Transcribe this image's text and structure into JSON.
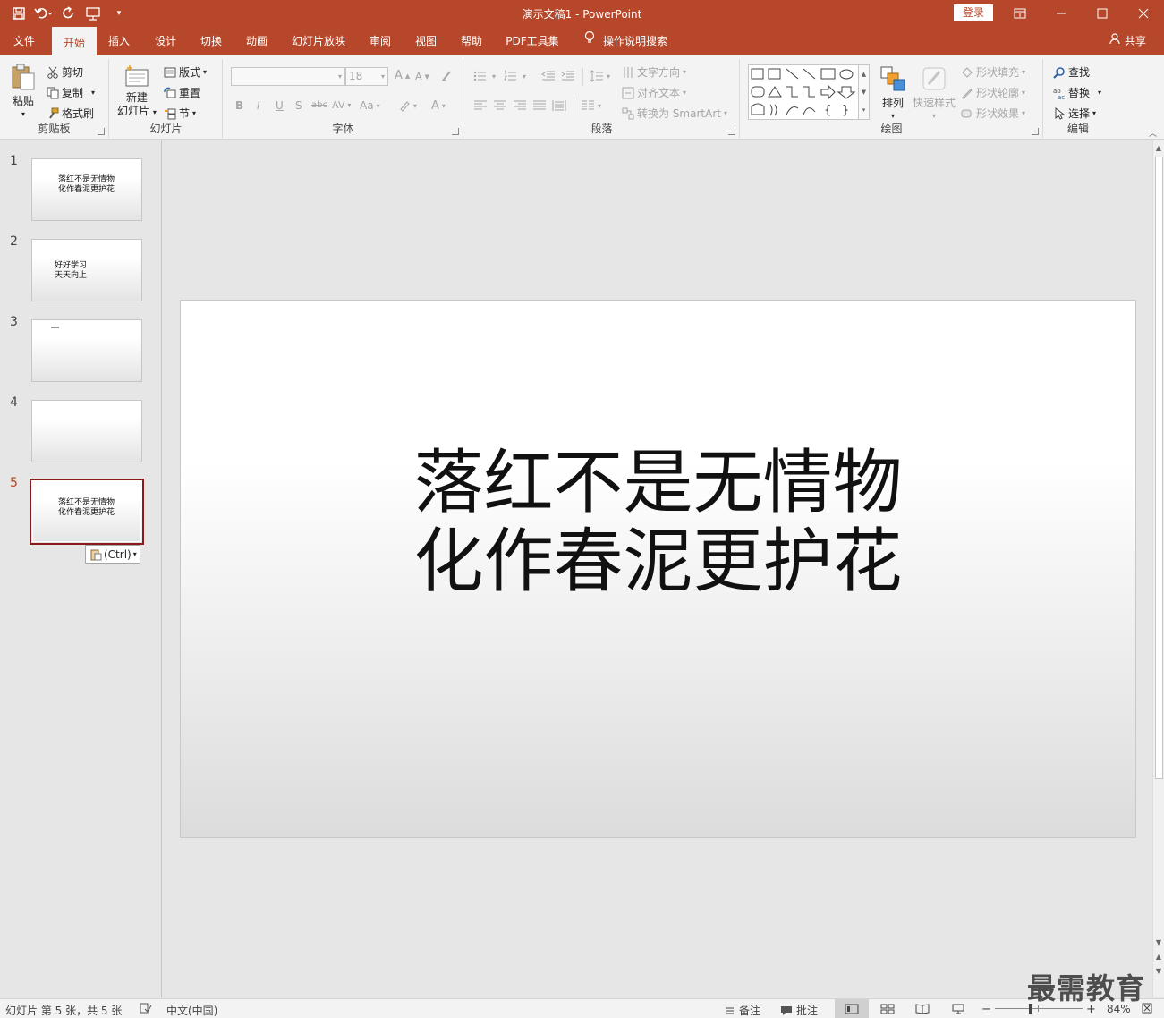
{
  "titlebar": {
    "doc_title": "演示文稿1  -  PowerPoint",
    "login": "登录",
    "bg_color": "#b7472a"
  },
  "tabs": [
    {
      "label": "文件"
    },
    {
      "label": "开始"
    },
    {
      "label": "插入"
    },
    {
      "label": "设计"
    },
    {
      "label": "切换"
    },
    {
      "label": "动画"
    },
    {
      "label": "幻灯片放映"
    },
    {
      "label": "审阅"
    },
    {
      "label": "视图"
    },
    {
      "label": "帮助"
    },
    {
      "label": "PDF工具集"
    }
  ],
  "tell_me": "操作说明搜索",
  "share": "共享",
  "ribbon": {
    "clipboard": {
      "label": "剪贴板",
      "paste": "粘贴",
      "cut": "剪切",
      "copy": "复制",
      "format_painter": "格式刷"
    },
    "slides": {
      "label": "幻灯片",
      "new_slide_1": "新建",
      "new_slide_2": "幻灯片",
      "layout": "版式",
      "reset": "重置",
      "section": "节"
    },
    "font": {
      "label": "字体",
      "size": "18",
      "bold": "B",
      "italic": "I",
      "underline": "U",
      "shadow": "S",
      "strike": "abc",
      "case": "Aa"
    },
    "paragraph": {
      "label": "段落",
      "text_direction": "文字方向",
      "align_text": "对齐文本",
      "smartart": "转换为 SmartArt"
    },
    "drawing": {
      "label": "绘图",
      "arrange": "排列",
      "quick_styles": "快速样式",
      "shape_fill": "形状填充",
      "shape_outline": "形状轮廓",
      "shape_effects": "形状效果"
    },
    "editing": {
      "label": "编辑",
      "find": "查找",
      "replace": "替换",
      "select": "选择"
    }
  },
  "thumbnails": [
    {
      "num": "1",
      "text": "落红不是无情物\n化作春泥更护花"
    },
    {
      "num": "2",
      "text": "好好学习\n天天向上"
    },
    {
      "num": "3",
      "text": ""
    },
    {
      "num": "4",
      "text": ""
    },
    {
      "num": "5",
      "text": "落红不是无情物\n化作春泥更护花"
    }
  ],
  "paste_options": "(Ctrl)",
  "slide": {
    "line1": "落红不是无情物",
    "line2": "化作春泥更护花"
  },
  "statusbar": {
    "slide_info": "幻灯片 第 5 张，共 5 张",
    "language": "中文(中国)",
    "notes": "备注",
    "comments": "批注",
    "zoom": "84%"
  },
  "watermark": "最需教育"
}
